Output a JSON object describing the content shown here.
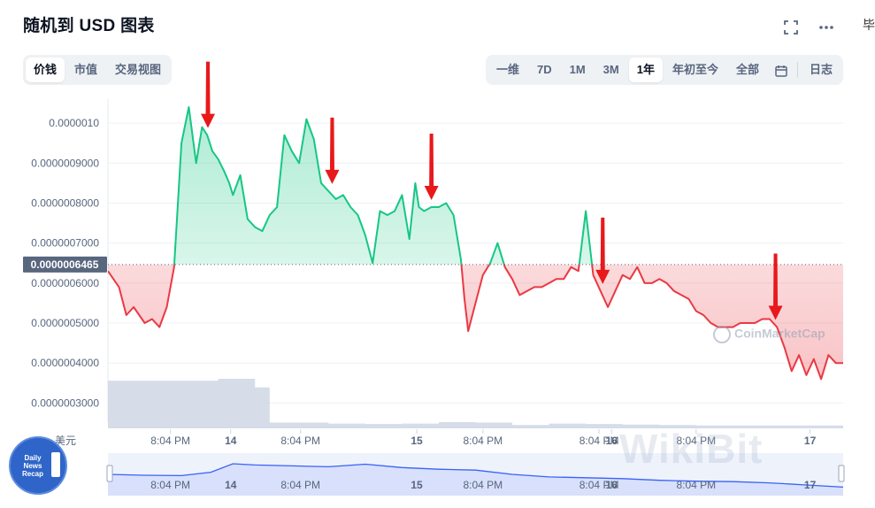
{
  "title": "随机到 USD 图表",
  "edge_char": "毕",
  "icons": {
    "fullscreen": "fullscreen-icon",
    "more": "more-dots-icon",
    "calendar": "calendar-icon"
  },
  "view_tabs": {
    "items": [
      "价钱",
      "市值",
      "交易视图"
    ],
    "active": 0
  },
  "range_tabs": {
    "items": [
      "一维",
      "7D",
      "1M",
      "3M",
      "1年",
      "年初至今",
      "全部"
    ],
    "active": 4,
    "log_label": "日志"
  },
  "currency_label": "美元",
  "current_price_label": "0.0000006465",
  "watermarks": {
    "chart": "CoinMarketCap",
    "brand": "WikiBit",
    "badge": [
      "Daily",
      "News",
      "Recap"
    ]
  },
  "colors": {
    "up": "#16c784",
    "down": "#ea3943",
    "volume": "#cfd6e4",
    "navigator": "#3861fb",
    "arrow": "#e8191a"
  },
  "chart_data": {
    "type": "line",
    "currency": "USD",
    "baseline": 6.465e-07,
    "y_ticks": [
      1e-06,
      9e-07,
      8e-07,
      7e-07,
      6e-07,
      5e-07,
      4e-07,
      3e-07
    ],
    "y_tick_labels": [
      "0.0000010",
      "0.0000009000",
      "0.0000008000",
      "0.0000007000",
      "0.0000006000",
      "0.0000005000",
      "0.0000004000",
      "0.0000003000"
    ],
    "ylim": [
      2.5e-07,
      1.06e-06
    ],
    "xlim": [
      0,
      100
    ],
    "x_ticks": [
      {
        "x": 8.5,
        "label": "8:04 PM"
      },
      {
        "x": 16.7,
        "label": "14"
      },
      {
        "x": 26.2,
        "label": "8:04 PM"
      },
      {
        "x": 42.0,
        "label": "15"
      },
      {
        "x": 51.0,
        "label": "8:04 PM"
      },
      {
        "x": 66.8,
        "label": "8:04 PM"
      },
      {
        "x": 68.5,
        "label": "16"
      },
      {
        "x": 80.0,
        "label": "8:04 PM"
      },
      {
        "x": 95.5,
        "label": "17"
      }
    ],
    "price_series": {
      "x": [
        0,
        1.5,
        2.5,
        3.5,
        5,
        6,
        7,
        8,
        9,
        10,
        11,
        12,
        12.8,
        13.5,
        14.2,
        15,
        15.8,
        16.5,
        17,
        18,
        19,
        20,
        21,
        22,
        23,
        24,
        25,
        26,
        27,
        28,
        29,
        30,
        31,
        32,
        33,
        34,
        35,
        36,
        37,
        38,
        39,
        40,
        41,
        41.8,
        42.3,
        43,
        44,
        45,
        46,
        47,
        48,
        48.5,
        49,
        50,
        51,
        52,
        53,
        54,
        55,
        56,
        57,
        58,
        59,
        60,
        61,
        62,
        63,
        64,
        65,
        66,
        67,
        68,
        69,
        70,
        71,
        72,
        73,
        74,
        75,
        76,
        77,
        78,
        79,
        80,
        81,
        82,
        83,
        84,
        85,
        86,
        87,
        88,
        89,
        90,
        91,
        92,
        93,
        94,
        95,
        96,
        97,
        98,
        99,
        100
      ],
      "y": [
        6.3e-07,
        5.9e-07,
        5.2e-07,
        5.4e-07,
        5e-07,
        5.1e-07,
        4.9e-07,
        5.4e-07,
        6.4e-07,
        9.5e-07,
        1.04e-06,
        9e-07,
        9.9e-07,
        9.7e-07,
        9.3e-07,
        9.1e-07,
        8.8e-07,
        8.5e-07,
        8.2e-07,
        8.7e-07,
        7.6e-07,
        7.4e-07,
        7.3e-07,
        7.7e-07,
        7.9e-07,
        9.7e-07,
        9.3e-07,
        9e-07,
        1.01e-06,
        9.6e-07,
        8.5e-07,
        8.3e-07,
        8.1e-07,
        8.2e-07,
        7.9e-07,
        7.7e-07,
        7.2e-07,
        6.5e-07,
        7.8e-07,
        7.7e-07,
        7.8e-07,
        8.2e-07,
        7.1e-07,
        8.5e-07,
        7.9e-07,
        7.8e-07,
        7.9e-07,
        7.9e-07,
        8e-07,
        7.7e-07,
        6.6e-07,
        5.6e-07,
        4.8e-07,
        5.5e-07,
        6.2e-07,
        6.5e-07,
        7e-07,
        6.4e-07,
        6.1e-07,
        5.7e-07,
        5.8e-07,
        5.9e-07,
        5.9e-07,
        6e-07,
        6.1e-07,
        6.1e-07,
        6.4e-07,
        6.3e-07,
        7.8e-07,
        6.2e-07,
        5.8e-07,
        5.4e-07,
        5.8e-07,
        6.2e-07,
        6.1e-07,
        6.4e-07,
        6e-07,
        6e-07,
        6.1e-07,
        6e-07,
        5.8e-07,
        5.7e-07,
        5.6e-07,
        5.3e-07,
        5.2e-07,
        5e-07,
        4.9e-07,
        4.9e-07,
        4.9e-07,
        5e-07,
        5e-07,
        5e-07,
        5.1e-07,
        5.1e-07,
        4.9e-07,
        4.4e-07,
        3.8e-07,
        4.2e-07,
        3.7e-07,
        4.1e-07,
        3.6e-07,
        4.2e-07,
        4e-07,
        4e-07
      ]
    },
    "volume_series": {
      "x": [
        0,
        5,
        10,
        15,
        19,
        20,
        22,
        25,
        30,
        35,
        40,
        45,
        50,
        55,
        60,
        65,
        70,
        75,
        80,
        85,
        90,
        95,
        100
      ],
      "values": [
        1.0,
        1.0,
        1.0,
        1.04,
        1.04,
        0.86,
        0.12,
        0.12,
        0.1,
        0.09,
        0.1,
        0.13,
        0.12,
        0.07,
        0.1,
        0.09,
        0.08,
        0.07,
        0.06,
        0.06,
        0.06,
        0.06,
        0.06
      ]
    },
    "navigator_series": {
      "x": [
        0,
        5,
        10,
        14,
        17,
        20,
        25,
        30,
        35,
        40,
        45,
        50,
        55,
        60,
        65,
        70,
        75,
        80,
        85,
        90,
        95,
        100
      ],
      "values": [
        0.5,
        0.48,
        0.47,
        0.55,
        0.75,
        0.72,
        0.7,
        0.68,
        0.74,
        0.66,
        0.62,
        0.6,
        0.5,
        0.44,
        0.42,
        0.4,
        0.36,
        0.34,
        0.33,
        0.3,
        0.25,
        0.2
      ]
    },
    "annotations": {
      "type": "down-arrows",
      "x": [
        13.6,
        30.5,
        44.0,
        67.3,
        90.8
      ]
    }
  }
}
